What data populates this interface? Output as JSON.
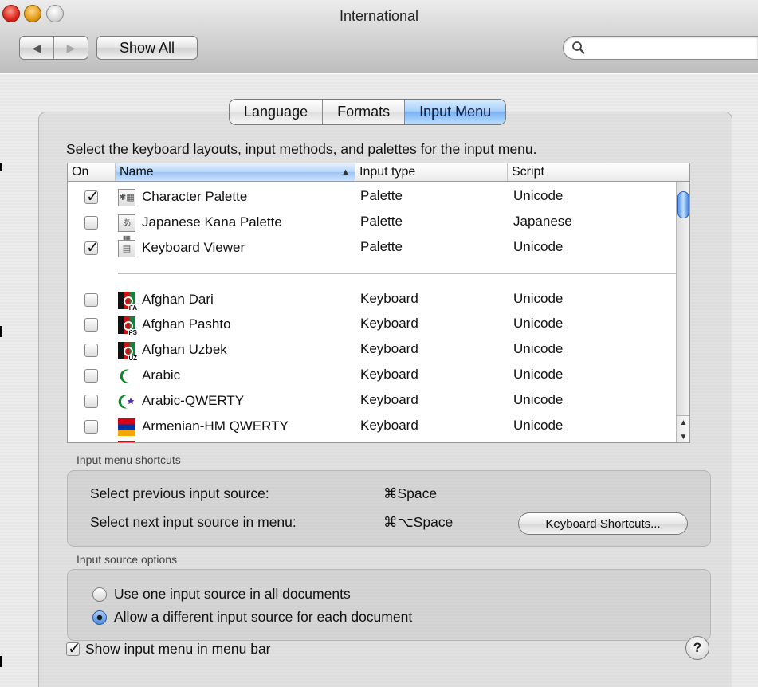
{
  "window": {
    "title": "International"
  },
  "toolbar": {
    "back_icon": "◀",
    "forward_icon": "▶",
    "show_all_label": "Show All",
    "search_placeholder": "",
    "search_value": ""
  },
  "tabs": [
    {
      "label": "Language",
      "active": false
    },
    {
      "label": "Formats",
      "active": false
    },
    {
      "label": "Input Menu",
      "active": true
    }
  ],
  "instruction": "Select the keyboard layouts, input methods, and palettes for the input menu.",
  "table": {
    "columns": {
      "on": "On",
      "name": "Name",
      "input_type": "Input type",
      "script": "Script"
    },
    "sort_indicator": "▲",
    "rows": [
      {
        "checked": true,
        "icon": "character-palette-icon",
        "name": "Character Palette",
        "input_type": "Palette",
        "script": "Unicode"
      },
      {
        "checked": false,
        "icon": "kana-palette-icon",
        "name": "Japanese Kana Palette",
        "input_type": "Palette",
        "script": "Japanese"
      },
      {
        "checked": true,
        "icon": "keyboard-viewer-icon",
        "name": "Keyboard Viewer",
        "input_type": "Palette",
        "script": "Unicode"
      },
      {
        "checked": false,
        "icon": "afghan-flag-icon",
        "name": "Afghan Dari",
        "input_type": "Keyboard",
        "script": "Unicode"
      },
      {
        "checked": false,
        "icon": "afghan-flag-icon",
        "name": "Afghan Pashto",
        "input_type": "Keyboard",
        "script": "Unicode"
      },
      {
        "checked": false,
        "icon": "afghan-flag-icon",
        "name": "Afghan Uzbek",
        "input_type": "Keyboard",
        "script": "Unicode"
      },
      {
        "checked": false,
        "icon": "crescent-icon",
        "name": "Arabic",
        "input_type": "Keyboard",
        "script": "Unicode"
      },
      {
        "checked": false,
        "icon": "crescent-star-icon",
        "name": "Arabic-QWERTY",
        "input_type": "Keyboard",
        "script": "Unicode"
      },
      {
        "checked": false,
        "icon": "armenian-flag-icon",
        "name": "Armenian-HM QWERTY",
        "input_type": "Keyboard",
        "script": "Unicode"
      }
    ]
  },
  "shortcuts": {
    "group_label": "Input menu shortcuts",
    "prev_label": "Select previous input source:",
    "prev_key": "⌘Space",
    "next_label": "Select next input source in menu:",
    "next_key": "⌘⌥Space",
    "keyboard_shortcuts_button": "Keyboard Shortcuts..."
  },
  "source_options": {
    "group_label": "Input source options",
    "option_one": "Use one input source in all documents",
    "option_two": "Allow a different input source for each document",
    "selected": "option_two"
  },
  "footer": {
    "show_menu_label": "Show input menu in menu bar",
    "show_menu_checked": true,
    "help_label": "?"
  }
}
